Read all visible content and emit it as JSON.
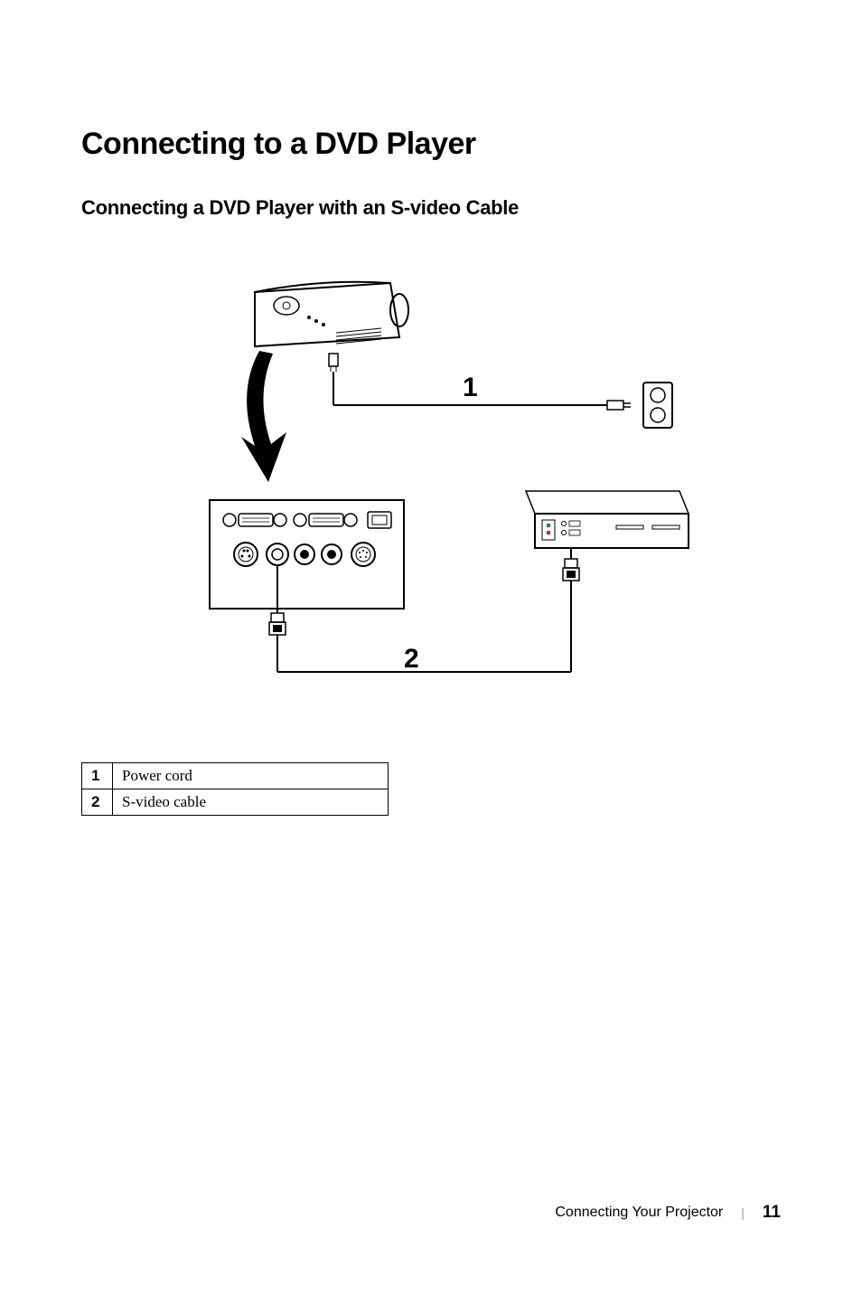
{
  "headings": {
    "main": "Connecting to a DVD Player",
    "sub": "Connecting a DVD Player with an S-video Cable"
  },
  "diagram": {
    "label1": "1",
    "label2": "2"
  },
  "legend": {
    "rows": [
      {
        "num": "1",
        "desc": "Power cord"
      },
      {
        "num": "2",
        "desc": "S-video cable"
      }
    ]
  },
  "footer": {
    "section": "Connecting Your Projector",
    "page": "11"
  }
}
